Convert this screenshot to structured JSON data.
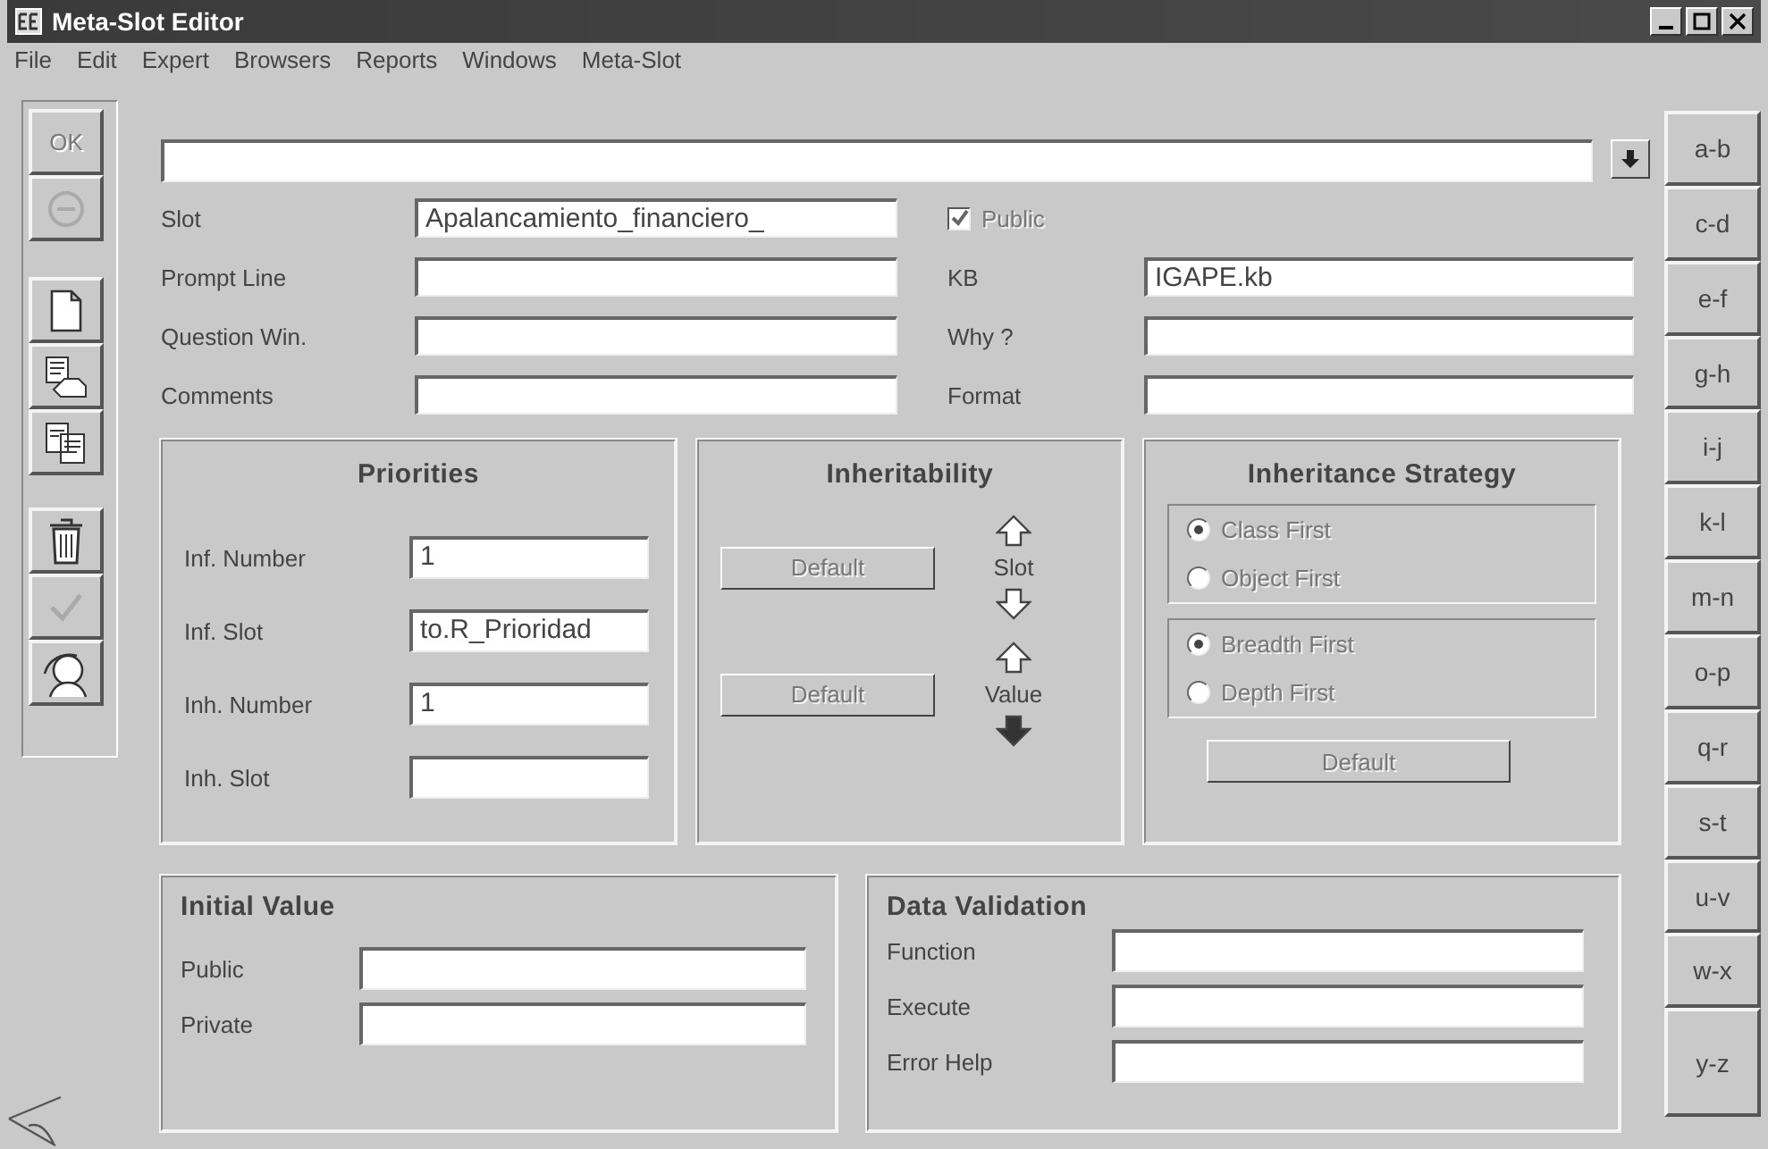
{
  "window": {
    "title": "Meta-Slot Editor"
  },
  "menu": [
    {
      "label": "File"
    },
    {
      "label": "Edit"
    },
    {
      "label": "Expert"
    },
    {
      "label": "Browsers"
    },
    {
      "label": "Reports"
    },
    {
      "label": "Windows"
    },
    {
      "label": "Meta-Slot"
    }
  ],
  "toolbar": [
    {
      "kind": "ok",
      "label": "OK",
      "disabled": true
    },
    {
      "kind": "stop",
      "disabled": true
    },
    {
      "kind": "new",
      "disabled": false
    },
    {
      "kind": "paste",
      "disabled": false
    },
    {
      "kind": "copy",
      "disabled": false
    },
    {
      "kind": "delete",
      "disabled": false
    },
    {
      "kind": "accept",
      "disabled": true
    },
    {
      "kind": "help",
      "disabled": false
    }
  ],
  "slot_fields": [
    {
      "label": "Slot",
      "value": "Apalancamiento_financiero_"
    },
    {
      "label": "Prompt Line"
    },
    {
      "label": "Question Win."
    },
    {
      "label": "Comments"
    }
  ],
  "public": {
    "label": "Public",
    "checked": true,
    "disabled": true
  },
  "info_fields": [
    {
      "label": "KB",
      "value": "IGAPE.kb"
    },
    {
      "label": "Why ?"
    },
    {
      "label": "Format"
    }
  ],
  "priorities": {
    "title": "Priorities",
    "fields": [
      {
        "label": "Inf. Number",
        "value": "1"
      },
      {
        "label": "Inf. Slot",
        "value": "to.R_Prioridad"
      },
      {
        "label": "Inh. Number",
        "value": "1"
      },
      {
        "label": "Inh. Slot"
      }
    ]
  },
  "inheritability": {
    "title": "Inheritability",
    "rows": [
      {
        "button": "Default",
        "button_disabled": true,
        "label": "Slot",
        "up_filled": false,
        "down_filled": false
      },
      {
        "button": "Default",
        "button_disabled": true,
        "label": "Value",
        "up_filled": false,
        "down_filled": true
      }
    ]
  },
  "strategy": {
    "title": "Inheritance Strategy",
    "groups": [
      [
        {
          "label": "Class First",
          "selected": true,
          "disabled": true
        },
        {
          "label": "Object First",
          "selected": false,
          "disabled": true
        }
      ],
      [
        {
          "label": "Breadth First",
          "selected": true,
          "disabled": true
        },
        {
          "label": "Depth First",
          "selected": false,
          "disabled": true
        }
      ]
    ],
    "button": {
      "label": "Default",
      "disabled": true
    }
  },
  "initial_value": {
    "title": "Initial Value",
    "fields": [
      {
        "label": "Public"
      },
      {
        "label": "Private"
      }
    ]
  },
  "data_validation": {
    "title": "Data Validation",
    "fields": [
      {
        "label": "Function"
      },
      {
        "label": "Execute"
      },
      {
        "label": "Error Help"
      }
    ]
  },
  "letter_tabs": [
    {
      "label": "a-b"
    },
    {
      "label": "c-d"
    },
    {
      "label": "e-f"
    },
    {
      "label": "g-h"
    },
    {
      "label": "i-j"
    },
    {
      "label": "k-l"
    },
    {
      "label": "m-n"
    },
    {
      "label": "o-p"
    },
    {
      "label": "q-r"
    },
    {
      "label": "s-t"
    },
    {
      "label": "u-v"
    },
    {
      "label": "w-x"
    },
    {
      "label": "y-z"
    }
  ]
}
